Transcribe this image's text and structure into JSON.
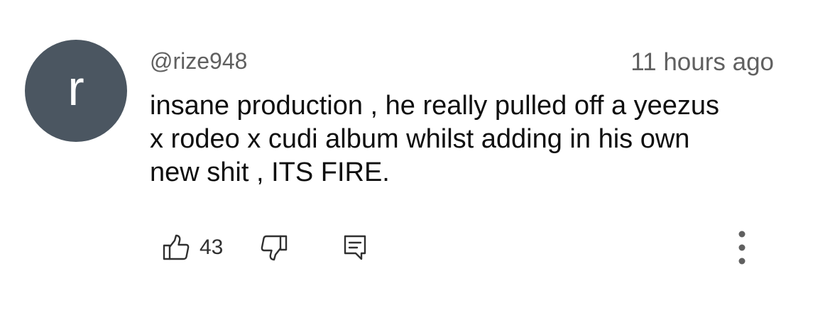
{
  "comment": {
    "avatar_letter": "r",
    "avatar_color": "#4b5661",
    "username": "@rize948",
    "timestamp": "11 hours ago",
    "text_lines": [
      "insane production , he really pulled off a yeezus",
      "x rodeo x cudi album whilst adding in his own",
      "new shit , ITS FIRE."
    ],
    "like_count": "43"
  },
  "icons": {
    "like": "thumbs-up-icon",
    "dislike": "thumbs-down-icon",
    "reply": "reply-icon",
    "more": "more-vert-icon"
  }
}
